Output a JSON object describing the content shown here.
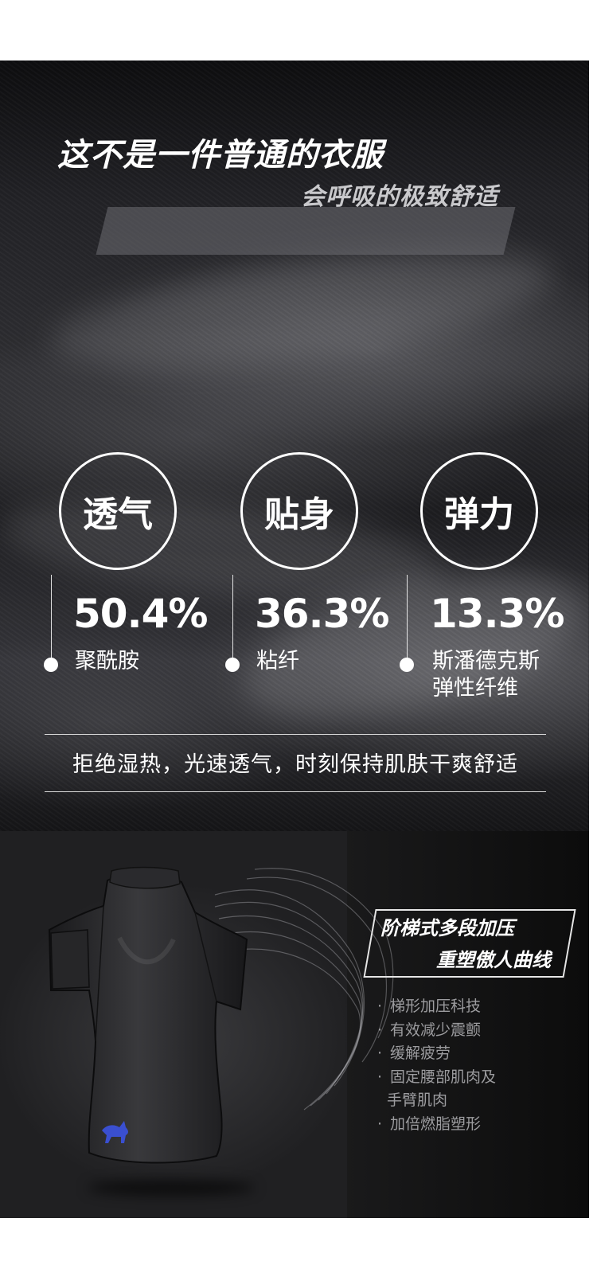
{
  "hero": {
    "headline": "这不是一件普通的衣服",
    "subheadline": "会呼吸的极致舒适"
  },
  "features": [
    {
      "label": "透气",
      "percent": "50.4%",
      "material": [
        "聚酰胺"
      ]
    },
    {
      "label": "贴身",
      "percent": "36.3%",
      "material": [
        "粘纤"
      ]
    },
    {
      "label": "弹力",
      "percent": "13.3%",
      "material": [
        "斯潘德克斯",
        "弹性纤维"
      ]
    }
  ],
  "tagline": "拒绝湿热，光速透气，时刻保持肌肤干爽舒适",
  "product": {
    "title_line1": "阶梯式多段加压",
    "title_line2": "重塑傲人曲线",
    "bullet_char": "·",
    "bullets": [
      "梯形加压科技",
      "有效减少震颤",
      "缓解疲劳",
      "固定腰部肌肉及",
      "手臂肌肉",
      "加倍燃脂塑形"
    ],
    "logo_color": "#3a4fd0"
  }
}
